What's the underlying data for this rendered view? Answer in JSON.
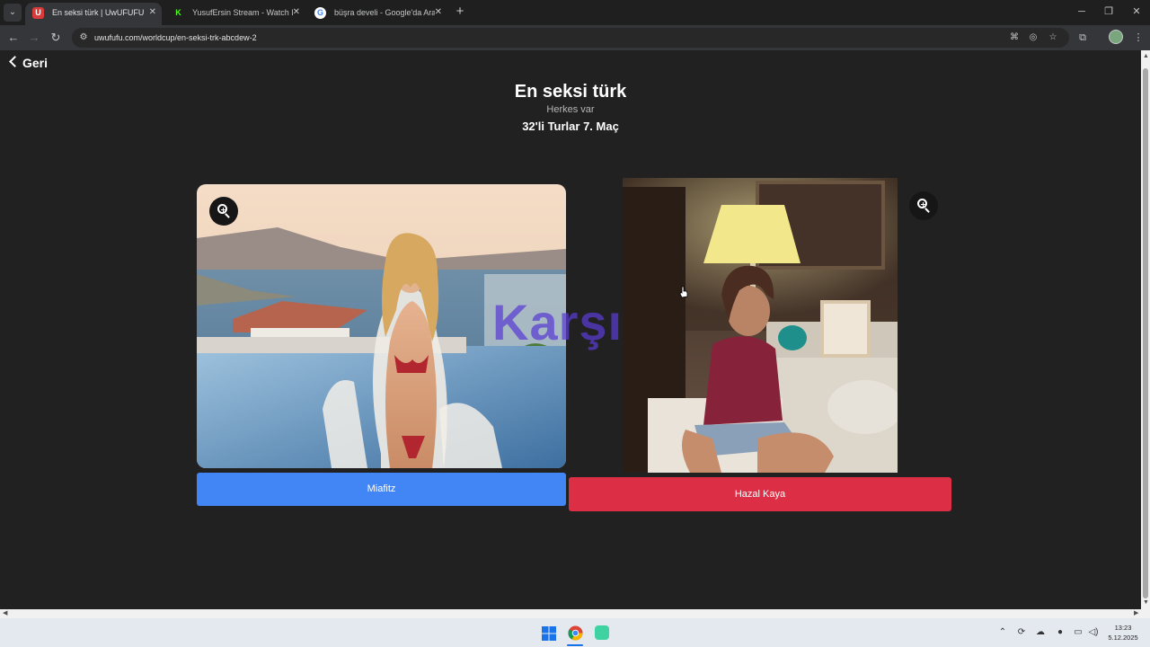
{
  "browser": {
    "tabs": [
      {
        "title": "En seksi türk | UwUFUFU",
        "favicon": "U",
        "active": true
      },
      {
        "title": "YusufErsin Stream - Watch Live",
        "favicon": "K",
        "active": false
      },
      {
        "title": "büşra develi - Google'da Ara",
        "favicon": "G",
        "active": false
      }
    ],
    "new_tab_label": "+",
    "url": "uwufufu.com/worldcup/en-seksi-trk-abcdew-2"
  },
  "page": {
    "back_label": "Geri",
    "title": "En seksi türk",
    "subtitle": "Herkes var",
    "round_label": "32'li Turlar 7. Maç",
    "versus_label": "Karşı",
    "left_choice": {
      "name": "Miafitz",
      "button_color": "#4285f4"
    },
    "right_choice": {
      "name": "Hazal Kaya",
      "button_color": "#dc2e45"
    }
  },
  "taskbar": {
    "time": "13:23",
    "date": "5.12.2025"
  }
}
